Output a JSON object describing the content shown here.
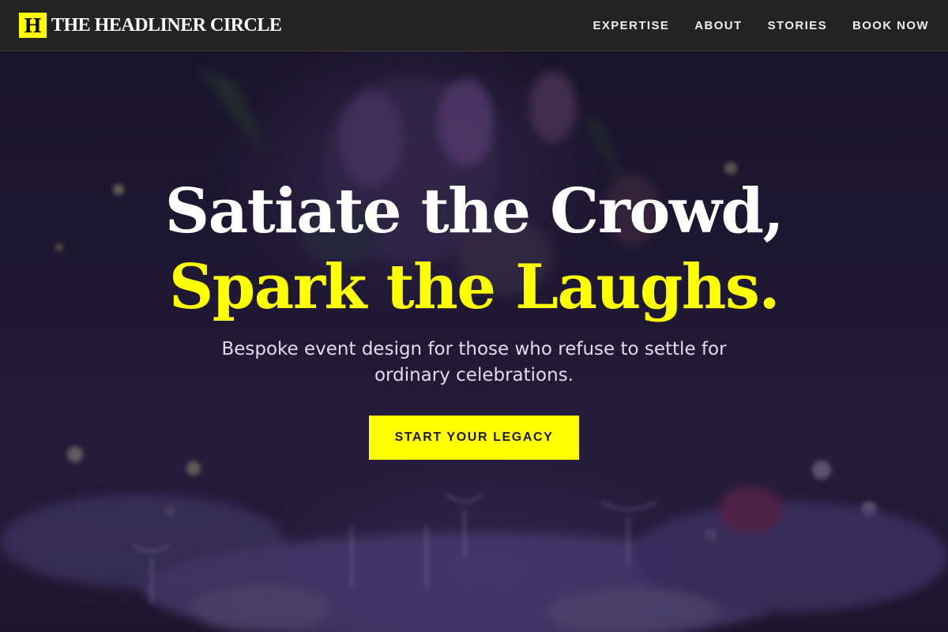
{
  "header": {
    "logo_letter": "H",
    "brand_name": "THE HEADLINER CIRCLE",
    "nav": [
      {
        "label": "EXPERTISE"
      },
      {
        "label": "ABOUT"
      },
      {
        "label": "STORIES"
      },
      {
        "label": "BOOK NOW"
      }
    ]
  },
  "hero": {
    "headline_line1": "Satiate the Crowd,",
    "headline_line2": "Spark the Laughs.",
    "subtitle": "Bespoke event design for those who refuse to settle for ordinary celebrations.",
    "cta_label": "START YOUR LEGACY"
  },
  "colors": {
    "accent": "#ffff00",
    "header_bg": "#232323",
    "hero_bg": "#241d3c"
  }
}
